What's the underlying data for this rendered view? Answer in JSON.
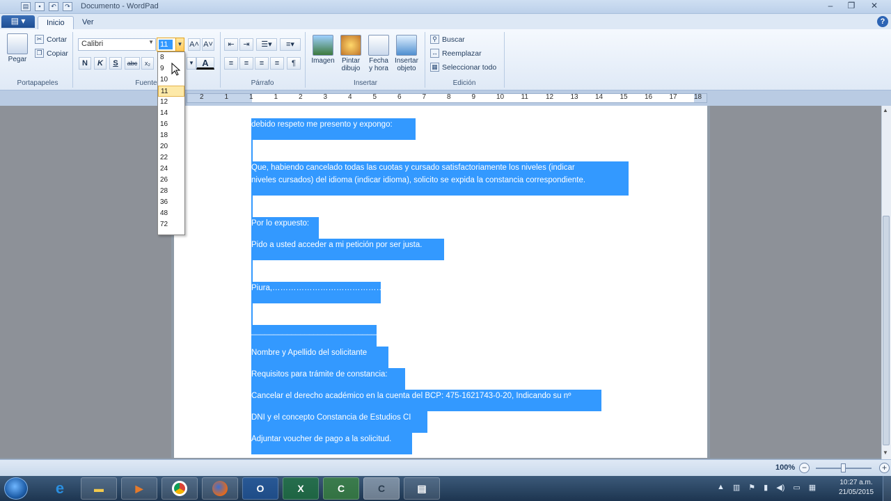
{
  "window": {
    "title": "Documento - WordPad",
    "controls": [
      "–",
      "❐",
      "✕"
    ]
  },
  "tabs": [
    "Inicio",
    "Ver"
  ],
  "help_label": "?",
  "ribbon": {
    "clipboard": {
      "paste": "Pegar",
      "cut": "Cortar",
      "copy": "Copiar",
      "label": "Portapapeles"
    },
    "font": {
      "family": "Calibri",
      "size": "11",
      "label": "Fuente",
      "bold": "N",
      "italic": "K",
      "underline": "S",
      "strike": "abc",
      "subscript": "x₂"
    },
    "paragraph": {
      "label": "Párrafo"
    },
    "insert": {
      "image": "Imagen",
      "paint": "Pintar dibujo",
      "paint_l1": "Pintar",
      "paint_l2": "dibujo",
      "date_l1": "Fecha",
      "date_l2": "y hora",
      "object_l1": "Insertar",
      "object_l2": "objeto",
      "label": "Insertar"
    },
    "edit": {
      "find": "Buscar",
      "replace": "Reemplazar",
      "select_all": "Seleccionar todo",
      "label": "Edición"
    }
  },
  "font_sizes": [
    "8",
    "9",
    "10",
    "11",
    "12",
    "14",
    "16",
    "18",
    "20",
    "22",
    "24",
    "26",
    "28",
    "36",
    "48",
    "72"
  ],
  "ruler_numbers": [
    "2",
    "1",
    "1",
    "1",
    "2",
    "3",
    "4",
    "5",
    "6",
    "7",
    "8",
    "9",
    "10",
    "11",
    "12",
    "13",
    "14",
    "15",
    "16",
    "17",
    "18"
  ],
  "document": {
    "lines": [
      "debido respeto me presento y expongo:",
      "",
      "Que, habiendo cancelado todas las cuotas y cursado satisfactoriamente los niveles (indicar",
      "niveles cursados) del idioma (indicar idioma), solicito se expida la constancia correspondiente.",
      "",
      "Por lo expuesto:",
      "Pido a usted acceder a mi petición por ser justa.",
      "",
      "Piura,………………………………………",
      "",
      "______________________________",
      "Nombre y Apellido del solicitante",
      "Requisitos para trámite de constancia:",
      "Cancelar el derecho académico en la cuenta del BCP: 475-1621743-0-20, Indicando su nº",
      "DNI y el concepto Constancia de Estudios CI",
      "Adjuntar voucher de pago a la solicitud."
    ]
  },
  "status": {
    "zoom": "100%"
  },
  "taskbar": {
    "apps": [
      "e",
      "",
      "",
      "",
      "",
      "O",
      "X",
      "C",
      "C",
      ""
    ],
    "clock_time": "10:27 a.m.",
    "clock_date": "21/05/2015"
  }
}
